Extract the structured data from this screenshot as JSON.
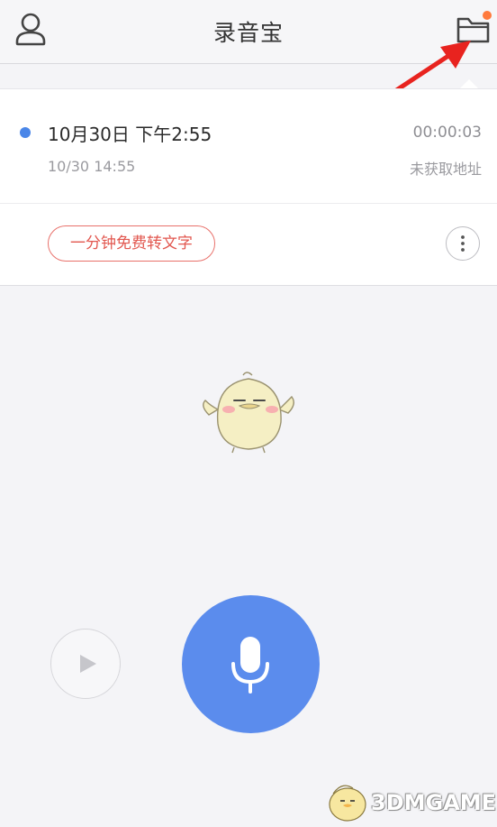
{
  "header": {
    "title": "录音宝"
  },
  "recording": {
    "name": "10月30日 下午2:55",
    "duration": "00:00:03",
    "date": "10/30  14:55",
    "location": "未获取地址",
    "convert_label": "一分钟免费转文字"
  },
  "watermark": {
    "text": "3DMGAME"
  },
  "colors": {
    "accent_blue": "#5b8ced",
    "convert_red": "#e2574f",
    "badge_orange": "#ff7a3d",
    "annotation_red": "#e8231f"
  }
}
